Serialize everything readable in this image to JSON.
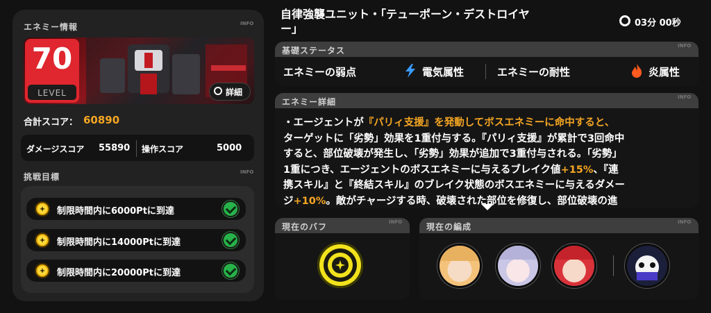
{
  "enemy_info": {
    "section_label": "エネミー情報",
    "info_tag": "INFO",
    "level_value": "70",
    "level_label": "LEVEL",
    "details_button": "詳細"
  },
  "score": {
    "total_label": "合計スコア：",
    "total_value": "60890",
    "damage_label": "ダメージスコア",
    "damage_value": "55890",
    "operation_label": "操作スコア",
    "operation_value": "5000"
  },
  "goals": {
    "section_label": "挑戦目標",
    "info_tag": "INFO",
    "items": [
      {
        "label": "制限時間内に6000Ptに到達"
      },
      {
        "label": "制限時間内に14000Ptに到達"
      },
      {
        "label": "制限時間内に20000Ptに到達"
      }
    ]
  },
  "header": {
    "title_line1": "自律強襲ユニット・「テューポーン・デストロイヤ",
    "title_line2": "ー」",
    "timer": "03分 00秒"
  },
  "basic_status": {
    "section_label": "基礎ステータス",
    "info_tag": "INFO",
    "weakness_label": "エネミーの弱点",
    "weakness_value": "電気属性",
    "resistance_label": "エネミーの耐性",
    "resistance_value": "炎属性",
    "colors": {
      "electric": "#3a9bff",
      "fire": "#ff5a1f"
    }
  },
  "enemy_detail": {
    "section_label": "エネミー詳細",
    "info_tag": "INFO",
    "lines": [
      {
        "a": "・エージェントが",
        "b": "『パリィ支援』を発動してボスエネミーに命中すると、",
        "c": ""
      },
      {
        "a": "ターゲットに「劣勢」効果を1重付与する。『パリィ支援』が累計で3回命中",
        "b": "",
        "c": ""
      },
      {
        "a": "すると、部位破壊が発生し、「劣勢」効果が追加で3重付与される。「劣勢」",
        "b": "",
        "c": ""
      },
      {
        "a": "1重につき、エージェントのボスエネミーに与えるブレイク値",
        "b": "+15%",
        "c": "、『連"
      },
      {
        "a": "携スキル』と『終結スキル』のブレイク状態のボスエネミーに与えるダメー",
        "b": "",
        "c": ""
      },
      {
        "a": "ジ",
        "b": "+10%",
        "c": "。敵がチャージする時、破壊された部位を修復し、部位破壊の進"
      }
    ]
  },
  "buff": {
    "section_label": "現在のバフ",
    "info_tag": "INFO"
  },
  "team": {
    "section_label": "現在の編成",
    "info_tag": "INFO",
    "members": [
      {
        "name": "agent-1",
        "color": "#f4c27a"
      },
      {
        "name": "agent-2",
        "color": "#c9c6e6"
      },
      {
        "name": "agent-3",
        "color": "#d9323a"
      },
      {
        "name": "bangboo",
        "color": "#1c1f3a"
      }
    ]
  }
}
